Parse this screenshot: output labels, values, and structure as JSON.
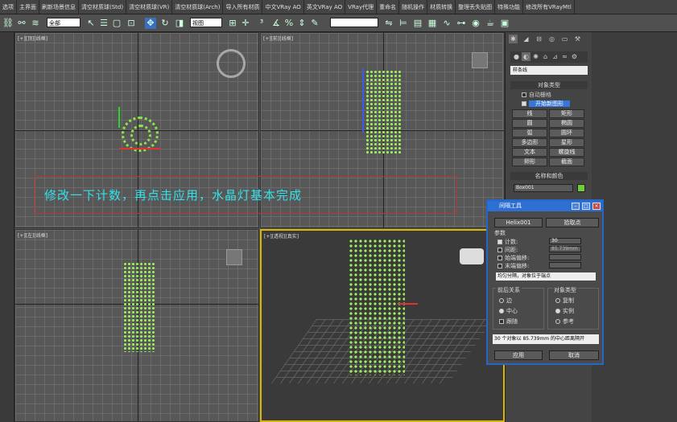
{
  "menu": [
    "选项",
    "主界面",
    "刷新场景信息",
    "清空材质球(Std)",
    "清空材质球(VR)",
    "清空材质球(Arch)",
    "导入所有材质",
    "中文VRay AO",
    "英文VRay AO",
    "VRay代理",
    "重命名",
    "随机操作",
    "材质转换",
    "整理丢失贴图",
    "特殊功能",
    "修改所有VRayMtl"
  ],
  "toolbar": {
    "selection_filter": "全部",
    "view_dropdown": "视图"
  },
  "viewports": {
    "top_label": "[+][顶][线框]",
    "front_label": "[+][前][线框]",
    "left_label": "[+][左][线框]",
    "persp_label": "[+][透视][真实]"
  },
  "annotation": "修改一下计数，再点击应用，水晶灯基本完成",
  "command_panel": {
    "category_dropdown": "样条线",
    "section_object_type": "对象类型",
    "auto_grid": "自动栅格",
    "start_new_shape": "开始新图形",
    "buttons": [
      "线",
      "矩形",
      "圆",
      "椭圆",
      "弧",
      "圆环",
      "多边形",
      "星形",
      "文本",
      "螺旋线",
      "卵形",
      "截面"
    ],
    "section_name_color": "名称和颜色",
    "object_name": "Box001"
  },
  "dialog": {
    "title": "间隔工具",
    "pick_path_label": "Helix001",
    "pick_points_label": "拾取点",
    "params_label": "参数",
    "count_label": "计数:",
    "count_value": "30",
    "spacing_label": "间距:",
    "spacing_value": "85.739mm",
    "start_offset_label": "始端偏移:",
    "end_offset_label": "末端偏移:",
    "distribution": "均匀分隔，对象位于端点",
    "front_back_label": "前后关系",
    "radio_edge": "边",
    "radio_center": "中心",
    "follow_label": "跟随",
    "object_type_label": "对象类型",
    "radio_copy": "复制",
    "radio_instance": "实例",
    "radio_reference": "参考",
    "status_text": "30 个对象以 85.739mm 的中心距离隔开",
    "apply_label": "应用",
    "cancel_label": "取消"
  },
  "colors": {
    "accent": "#2e6fd3",
    "annotation_text": "#33e0e8",
    "object_green": "#8ee34a"
  }
}
